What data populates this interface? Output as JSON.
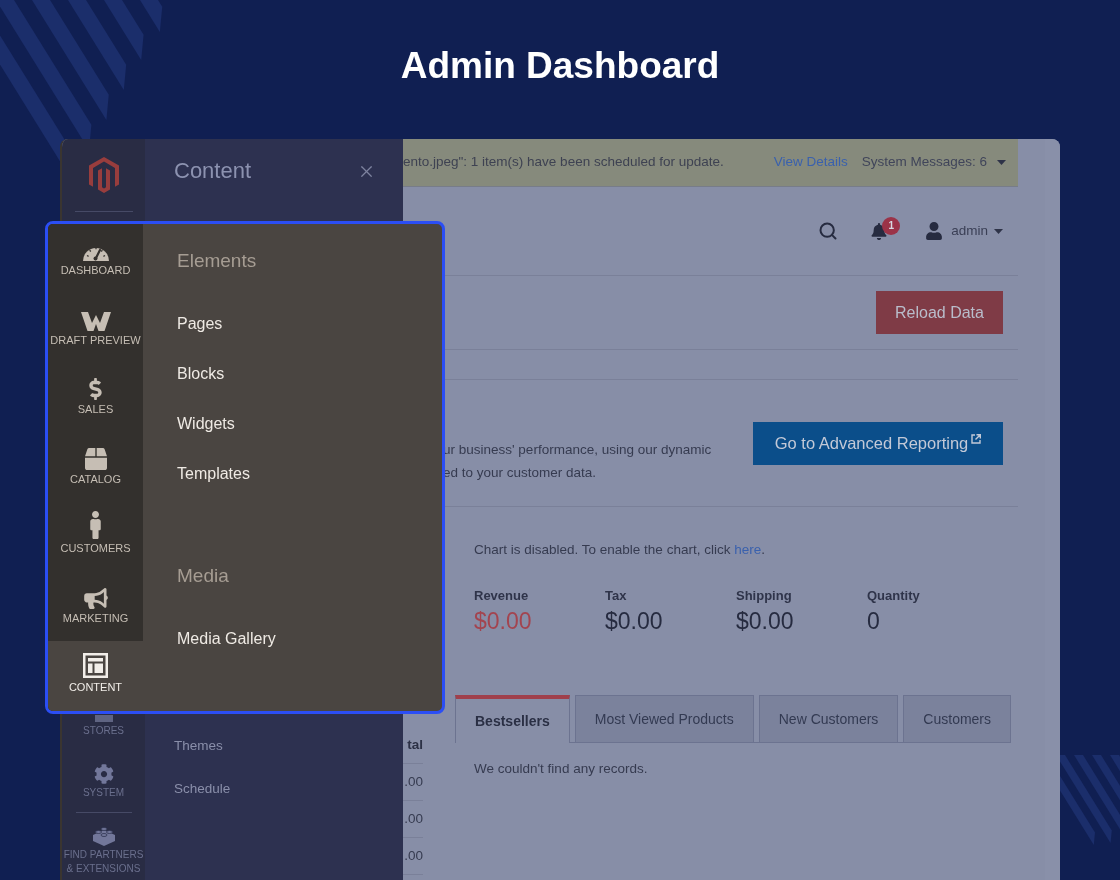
{
  "heading": "Admin Dashboard",
  "sidebar": {
    "items": [
      {
        "label": "STORES"
      },
      {
        "label": "SYSTEM"
      },
      {
        "label": "FIND PARTNERS & EXTENSIONS"
      }
    ]
  },
  "flyout": {
    "title": "Content",
    "items": [
      "Themes",
      "Schedule"
    ]
  },
  "system_messages": {
    "message": "ento.jpeg\": 1 item(s) have been scheduled for update.",
    "link": "View Details",
    "summary": "System Messages: 6"
  },
  "header": {
    "notification_count": "1",
    "user": "admin"
  },
  "reload_button": "Reload Data",
  "advanced_reporting": {
    "text_lines": [
      "ur business' performance, using our dynamic",
      "ed to your customer data."
    ],
    "button": "Go to Advanced Reporting"
  },
  "chart_notice": {
    "text": "Chart is disabled. To enable the chart, click ",
    "link": "here",
    "end": "."
  },
  "totals": [
    {
      "label": "Revenue",
      "value": "$0.00",
      "accent": true
    },
    {
      "label": "Tax",
      "value": "$0.00",
      "accent": false
    },
    {
      "label": "Shipping",
      "value": "$0.00",
      "accent": false
    },
    {
      "label": "Quantity",
      "value": "0",
      "accent": false
    }
  ],
  "orders_table": {
    "column_header": "tal",
    "cells": [
      ".00",
      ".00",
      ".00"
    ]
  },
  "tabs": [
    {
      "label": "Bestsellers",
      "selected": true
    },
    {
      "label": "Most Viewed Products",
      "selected": false
    },
    {
      "label": "New Customers",
      "selected": false
    },
    {
      "label": "Customers",
      "selected": false
    }
  ],
  "tab_panel": {
    "empty_message": "We couldn't find any records."
  },
  "spotlight": {
    "nav": [
      {
        "label": "DASHBOARD",
        "selected": false
      },
      {
        "label": "DRAFT PREVIEW",
        "selected": false
      },
      {
        "label": "SALES",
        "selected": false
      },
      {
        "label": "CATALOG",
        "selected": false
      },
      {
        "label": "CUSTOMERS",
        "selected": false
      },
      {
        "label": "MARKETING",
        "selected": false
      },
      {
        "label": "CONTENT",
        "selected": true
      }
    ],
    "sections": [
      {
        "heading": "Elements",
        "items": [
          "Pages",
          "Blocks",
          "Widgets",
          "Templates"
        ]
      },
      {
        "heading": "Media",
        "items": [
          "Media Gallery"
        ]
      }
    ]
  }
}
